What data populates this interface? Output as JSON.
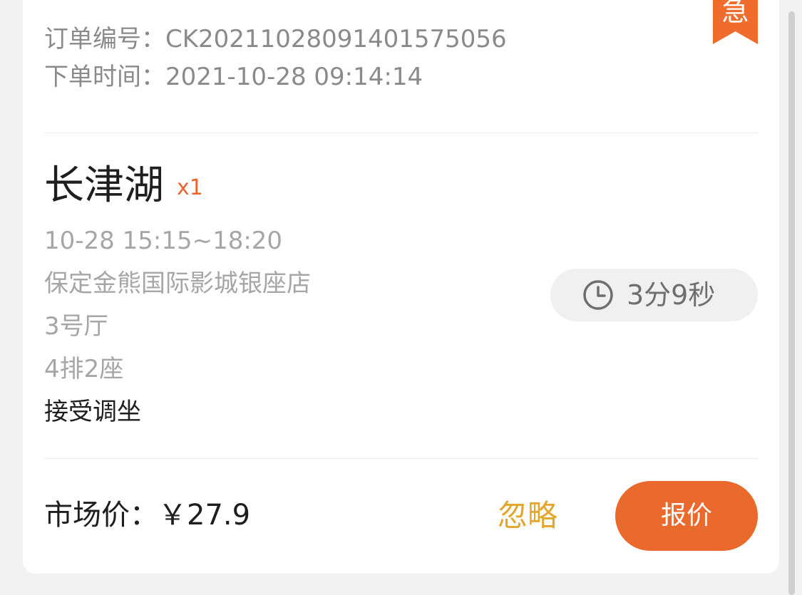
{
  "badge": {
    "text": "急",
    "color": "#f06c2c"
  },
  "order": {
    "number_label": "订单编号：",
    "number_value": "CK20211028091401575056",
    "time_label": "下单时间：",
    "time_value": "2021-10-28 09:14:14"
  },
  "movie": {
    "title": "长津湖",
    "quantity": "x1",
    "showtime": "10-28 15:15~18:20",
    "cinema": "保定金熊国际影城银座店",
    "hall": "3号厅",
    "seat": "4排2座",
    "seat_adjust": "接受调坐"
  },
  "timer": {
    "icon": "clock-icon",
    "text": "3分9秒"
  },
  "footer": {
    "price_label": "市场价：",
    "price_value": "￥27.9",
    "ignore_label": "忽略",
    "quote_label": "报价"
  },
  "colors": {
    "accent": "#ea6a2d",
    "ignore": "#e3a52a"
  }
}
